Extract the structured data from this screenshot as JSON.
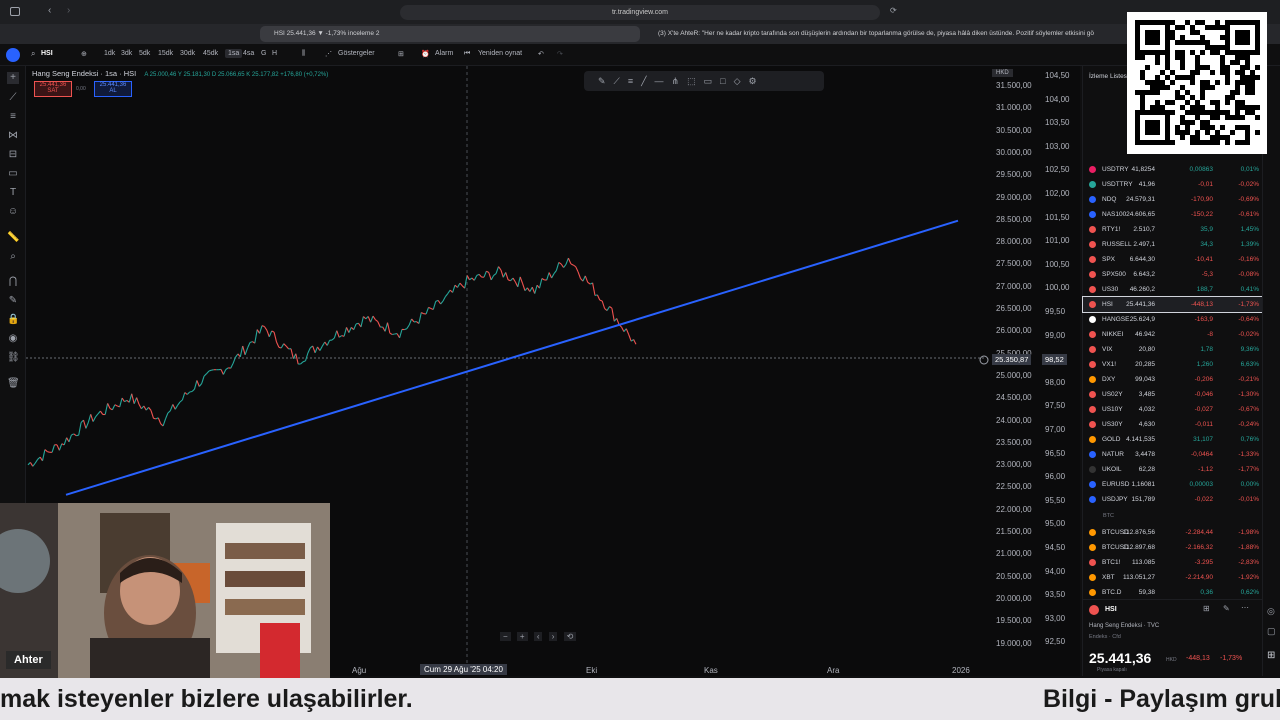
{
  "browser": {
    "url": "tr.tradingview.com",
    "tab_active": "HSI 25.441,36 ▼ -1,73% inceleme 2",
    "tab_other": "(3) X'te AhteR: \"Her ne kadar kripto tarafında son düşüşlerin ardından bir toparlanma görülse de, piyasa hâlâ diken üstünde. Pozitif söylemler etkisini gö"
  },
  "toolbar": {
    "symbol": "HSI",
    "intervals": [
      "1dk",
      "3dk",
      "5dk",
      "15dk",
      "30dk",
      "45dk",
      "1sa",
      "4sa",
      "G",
      "H"
    ],
    "selected_interval": "1sa",
    "indicators_label": "Göstergeler",
    "alert_label": "Alarm",
    "replay_label": "Yeniden oynat"
  },
  "chart": {
    "title": "Hang Seng Endeksi · 1sa · HSI",
    "ohlc": "A 25.000,46  Y 25.181,30  D 25.066,65  K 25.177,82  +176,80 (+0,72%)",
    "sell_price": "25.441,36",
    "sell_label": "SAT",
    "spread": "0,00",
    "buy_price": "25.441,36",
    "buy_label": "AL",
    "currency": "HKD",
    "price_axis": [
      "31.500,00",
      "31.000,00",
      "30.500,00",
      "30.000,00",
      "29.500,00",
      "29.000,00",
      "28.500,00",
      "28.000,00",
      "27.500,00",
      "27.000,00",
      "26.500,00",
      "26.000,00",
      "25.500,00",
      "25.000,00",
      "24.500,00",
      "24.000,00",
      "23.500,00",
      "23.000,00",
      "22.500,00",
      "22.000,00",
      "21.500,00",
      "21.000,00",
      "20.500,00",
      "20.000,00",
      "19.500,00",
      "19.000,00"
    ],
    "pct_axis": [
      "104,50",
      "104,00",
      "103,50",
      "103,00",
      "102,50",
      "102,00",
      "101,50",
      "101,00",
      "100,50",
      "100,00",
      "99,50",
      "99,00",
      "98,52",
      "98,00",
      "97,50",
      "97,00",
      "96,50",
      "96,00",
      "95,50",
      "95,00",
      "94,50",
      "94,00",
      "93,50",
      "93,00",
      "92,50"
    ],
    "crosshair_price": "25.350,87",
    "time_axis": [
      "Ağu",
      "Eki",
      "Kas",
      "Ara",
      "2026"
    ],
    "crosshair_time": "Cum 29 Ağu '25  04:20"
  },
  "chart_data": {
    "type": "line",
    "title": "Hang Seng Endeksi · 1sa · HSI",
    "ylim": [
      19000,
      31500
    ],
    "x_labels": [
      "Ağu",
      "Eki",
      "Kas",
      "Ara",
      "2026"
    ],
    "series": [
      {
        "values": [
          22850,
          23300,
          23900,
          24300,
          23800,
          24600,
          25000,
          25800,
          25100,
          25600,
          26000,
          25700,
          26200,
          26800,
          27000,
          26600,
          27300,
          26400,
          25441
        ]
      }
    ],
    "trendline": {
      "color": "#2962ff",
      "from": 22200,
      "to": 28100
    }
  },
  "watchlist": {
    "title": "İzleme Listesi",
    "rows": [
      {
        "sym": "USDTRY",
        "last": "41,8254",
        "chg": "0,00863",
        "pct": "0,01%",
        "dir": "pos",
        "color": "#e91e63"
      },
      {
        "sym": "USDTTRY",
        "last": "41,96",
        "chg": "-0,01",
        "pct": "-0,02%",
        "dir": "neg",
        "color": "#26a69a"
      },
      {
        "sym": "NDQ",
        "last": "24.579,31",
        "chg": "-170,90",
        "pct": "-0,69%",
        "dir": "neg",
        "color": "#2962ff"
      },
      {
        "sym": "NAS100",
        "last": "24.606,65",
        "chg": "-150,22",
        "pct": "-0,61%",
        "dir": "neg",
        "color": "#2962ff"
      },
      {
        "sym": "RTY1!",
        "last": "2.510,7",
        "chg": "35,9",
        "pct": "1,45%",
        "dir": "pos",
        "color": "#ef5350"
      },
      {
        "sym": "RUSSELL",
        "last": "2.497,1",
        "chg": "34,3",
        "pct": "1,39%",
        "dir": "pos",
        "color": "#ef5350"
      },
      {
        "sym": "SPX",
        "last": "6.644,30",
        "chg": "-10,41",
        "pct": "-0,16%",
        "dir": "neg",
        "color": "#ef5350"
      },
      {
        "sym": "SPX500",
        "last": "6.643,2",
        "chg": "-5,3",
        "pct": "-0,08%",
        "dir": "neg",
        "color": "#ef5350"
      },
      {
        "sym": "US30",
        "last": "46.260,2",
        "chg": "188,7",
        "pct": "0,41%",
        "dir": "pos",
        "color": "#ef5350"
      },
      {
        "sym": "HSI",
        "last": "25.441,36",
        "chg": "-448,13",
        "pct": "-1,73%",
        "dir": "neg",
        "color": "#ef5350"
      },
      {
        "sym": "HANGSE",
        "last": "25.624,9",
        "chg": "-163,9",
        "pct": "-0,64%",
        "dir": "neg",
        "color": "#ffffff"
      },
      {
        "sym": "NIKKEI",
        "last": "46.942",
        "chg": "-8",
        "pct": "-0,02%",
        "dir": "neg",
        "color": "#ef5350"
      },
      {
        "sym": "VIX",
        "last": "20,80",
        "chg": "1,78",
        "pct": "9,36%",
        "dir": "pos",
        "color": "#ef5350"
      },
      {
        "sym": "VX1!",
        "last": "20,285",
        "chg": "1,260",
        "pct": "6,63%",
        "dir": "pos",
        "color": "#ef5350"
      },
      {
        "sym": "DXY",
        "last": "99,043",
        "chg": "-0,206",
        "pct": "-0,21%",
        "dir": "neg",
        "color": "#ff9800"
      },
      {
        "sym": "US02Y",
        "last": "3,485",
        "chg": "-0,046",
        "pct": "-1,30%",
        "dir": "neg",
        "color": "#ef5350"
      },
      {
        "sym": "US10Y",
        "last": "4,032",
        "chg": "-0,027",
        "pct": "-0,67%",
        "dir": "neg",
        "color": "#ef5350"
      },
      {
        "sym": "US30Y",
        "last": "4,630",
        "chg": "-0,011",
        "pct": "-0,24%",
        "dir": "neg",
        "color": "#ef5350"
      },
      {
        "sym": "GOLD",
        "last": "4.141,535",
        "chg": "31,107",
        "pct": "0,76%",
        "dir": "pos",
        "color": "#ff9800"
      },
      {
        "sym": "NATUR",
        "last": "3,4478",
        "chg": "-0,0464",
        "pct": "-1,33%",
        "dir": "neg",
        "color": "#2962ff"
      },
      {
        "sym": "UKOIL",
        "last": "62,28",
        "chg": "-1,12",
        "pct": "-1,77%",
        "dir": "neg",
        "color": "#333333"
      },
      {
        "sym": "EURUSD",
        "last": "1,16081",
        "chg": "0,00003",
        "pct": "0,00%",
        "dir": "pos",
        "color": "#2962ff"
      },
      {
        "sym": "USDJPY",
        "last": "151,789",
        "chg": "-0,022",
        "pct": "-0,01%",
        "dir": "neg",
        "color": "#2962ff"
      }
    ],
    "section_btc": "BTC",
    "btc_rows": [
      {
        "sym": "BTCUSD",
        "last": "112.876,56",
        "chg": "-2.284,44",
        "pct": "-1,98%",
        "dir": "neg",
        "color": "#ff9800"
      },
      {
        "sym": "BTCUSD",
        "last": "112.897,68",
        "chg": "-2.166,32",
        "pct": "-1,88%",
        "dir": "neg",
        "color": "#ff9800"
      },
      {
        "sym": "BTC1!",
        "last": "113.085",
        "chg": "-3.295",
        "pct": "-2,83%",
        "dir": "neg",
        "color": "#ef5350"
      },
      {
        "sym": "XBT",
        "last": "113.051,27",
        "chg": "-2.214,90",
        "pct": "-1,92%",
        "dir": "neg",
        "color": "#ff9800"
      },
      {
        "sym": "BTC.D",
        "last": "59,38",
        "chg": "0,36",
        "pct": "0,62%",
        "dir": "pos",
        "color": "#ff9800"
      }
    ],
    "detail": {
      "symbol": "HSI",
      "name": "Hang Seng Endeksi · TVC",
      "sub": "Endeks · Cfd",
      "price": "25.441,36",
      "currency": "HKD",
      "change": "-448,13",
      "change_pct": "-1,73%",
      "status": "Piyasa kapalı"
    }
  },
  "webcam": {
    "name": "Ahter"
  },
  "ticker": {
    "left": "mak isteyenler bizlere ulaşabilirler.",
    "right": "Bilgi - Paylaşım grub"
  }
}
